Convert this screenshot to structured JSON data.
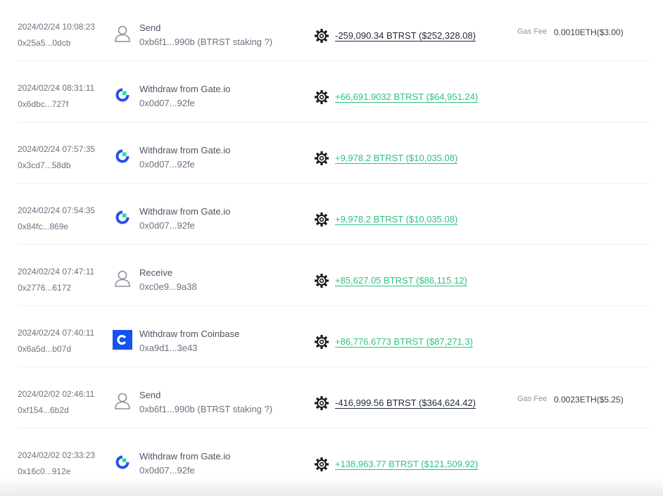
{
  "transactions": [
    {
      "time": "2024/02/24 10:08:23",
      "hash": "0x25a5...0dcb",
      "avatar": "user-icon",
      "title": "Send",
      "address": "0xb6f1...990b (BTRST staking ?)",
      "amount": "-259,090.34 BTRST ($252,328.08)",
      "direction": "out",
      "gas_label": "Gas Fee",
      "gas_value": "0.0010ETH($3.00)"
    },
    {
      "time": "2024/02/24 08:31:11",
      "hash": "0x6dbc...727f",
      "avatar": "gate-io-logo",
      "title": "Withdraw from Gate.io",
      "address": "0x0d07...92fe",
      "amount": "+66,691.9032 BTRST ($64,951.24)",
      "direction": "in",
      "gas_label": "",
      "gas_value": ""
    },
    {
      "time": "2024/02/24 07:57:35",
      "hash": "0x3cd7...58db",
      "avatar": "gate-io-logo",
      "title": "Withdraw from Gate.io",
      "address": "0x0d07...92fe",
      "amount": "+9,978.2 BTRST ($10,035.08)",
      "direction": "in",
      "gas_label": "",
      "gas_value": ""
    },
    {
      "time": "2024/02/24 07:54:35",
      "hash": "0x84fc...869e",
      "avatar": "gate-io-logo",
      "title": "Withdraw from Gate.io",
      "address": "0x0d07...92fe",
      "amount": "+9,978.2 BTRST ($10,035.08)",
      "direction": "in",
      "gas_label": "",
      "gas_value": ""
    },
    {
      "time": "2024/02/24 07:47:11",
      "hash": "0x2776...6172",
      "avatar": "user-icon",
      "title": "Receive",
      "address": "0xc0e9...9a38",
      "amount": "+85,627.05 BTRST ($86,115.12)",
      "direction": "in",
      "gas_label": "",
      "gas_value": ""
    },
    {
      "time": "2024/02/24 07:40:11",
      "hash": "0x6a5d...b07d",
      "avatar": "coinbase-logo",
      "title": "Withdraw from Coinbase",
      "address": "0xa9d1...3e43",
      "amount": "+86,776.6773 BTRST ($87,271.3)",
      "direction": "in",
      "gas_label": "",
      "gas_value": ""
    },
    {
      "time": "2024/02/02 02:46:11",
      "hash": "0xf154...6b2d",
      "avatar": "user-icon",
      "title": "Send",
      "address": "0xb6f1...990b (BTRST staking ?)",
      "amount": "-416,999.56 BTRST ($364,624.42)",
      "direction": "out",
      "gas_label": "Gas Fee",
      "gas_value": "0.0023ETH($5.25)"
    },
    {
      "time": "2024/02/02 02:33:23",
      "hash": "0x16c0...912e",
      "avatar": "gate-io-logo",
      "title": "Withdraw from Gate.io",
      "address": "0x0d07...92fe",
      "amount": "+138,963.77 BTRST ($121,509.92)",
      "direction": "in",
      "gas_label": "",
      "gas_value": ""
    }
  ],
  "token_icon": "btrst-gear-icon",
  "colors": {
    "positive": "#2ec27e",
    "negative": "#1f2937",
    "gate_blue": "#2354e6",
    "gate_green": "#17e6a1",
    "coinbase_blue": "#1652f0"
  }
}
